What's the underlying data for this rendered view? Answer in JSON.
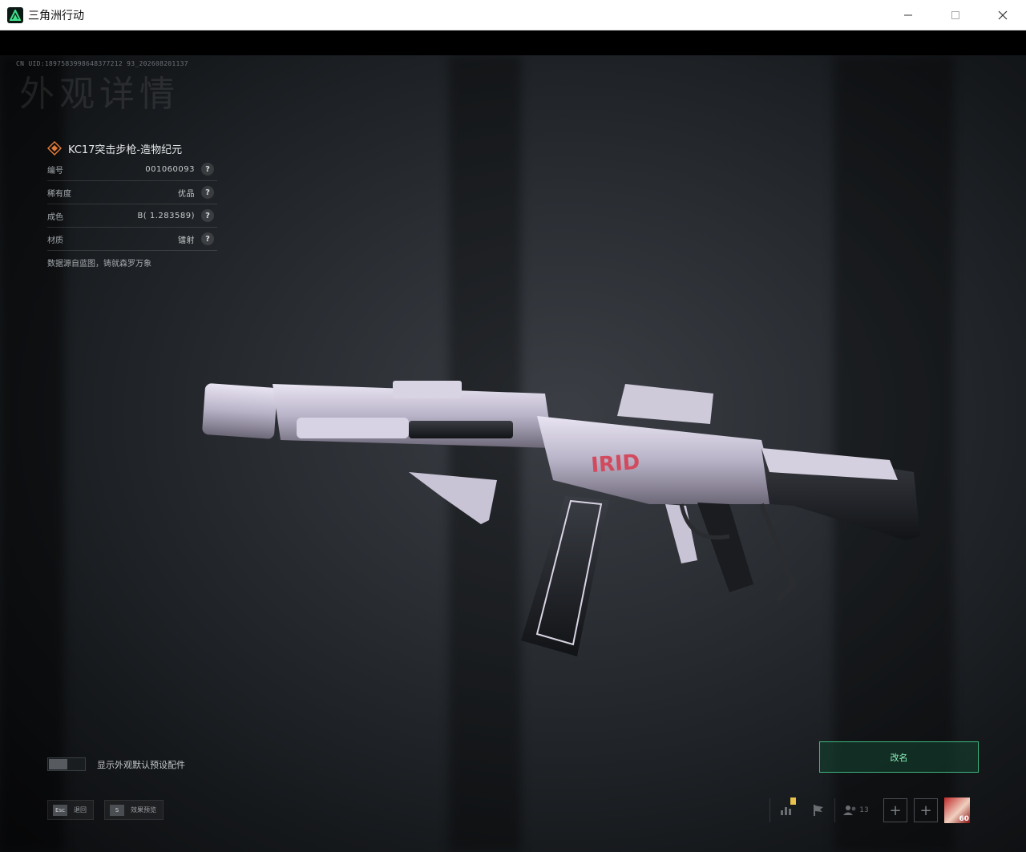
{
  "window": {
    "title": "三角洲行动",
    "minimize_icon": "minimize-icon",
    "maximize_icon": "maximize-icon",
    "close_icon": "close-icon"
  },
  "header": {
    "uid": "CN UID:1897583998648377212 93_202608201137",
    "ghost_title": "外观详情"
  },
  "item": {
    "name": "KC17突击步枪-造物纪元",
    "description": "数据源自蓝图，铸就森罗万象",
    "rows": [
      {
        "label": "编号",
        "value": "001060093"
      },
      {
        "label": "稀有度",
        "value": "优品"
      },
      {
        "label": "成色",
        "value": "B( 1.283589)"
      },
      {
        "label": "材质",
        "value": "镭射"
      }
    ],
    "help_glyph": "?",
    "accent": "#e07a3a"
  },
  "weapon": {
    "decal_text": "IRID"
  },
  "toggle": {
    "label": "显示外观默认预设配件",
    "state": "off"
  },
  "rename_button": {
    "label": "改名",
    "color": "#3fb77f"
  },
  "hotkeys": [
    {
      "key": "Esc",
      "label": "退回"
    },
    {
      "key": "S",
      "label": "效果预览"
    }
  ],
  "status_bar": {
    "friends_count": "13",
    "avatar_level": "60",
    "plus_glyph": "+"
  }
}
